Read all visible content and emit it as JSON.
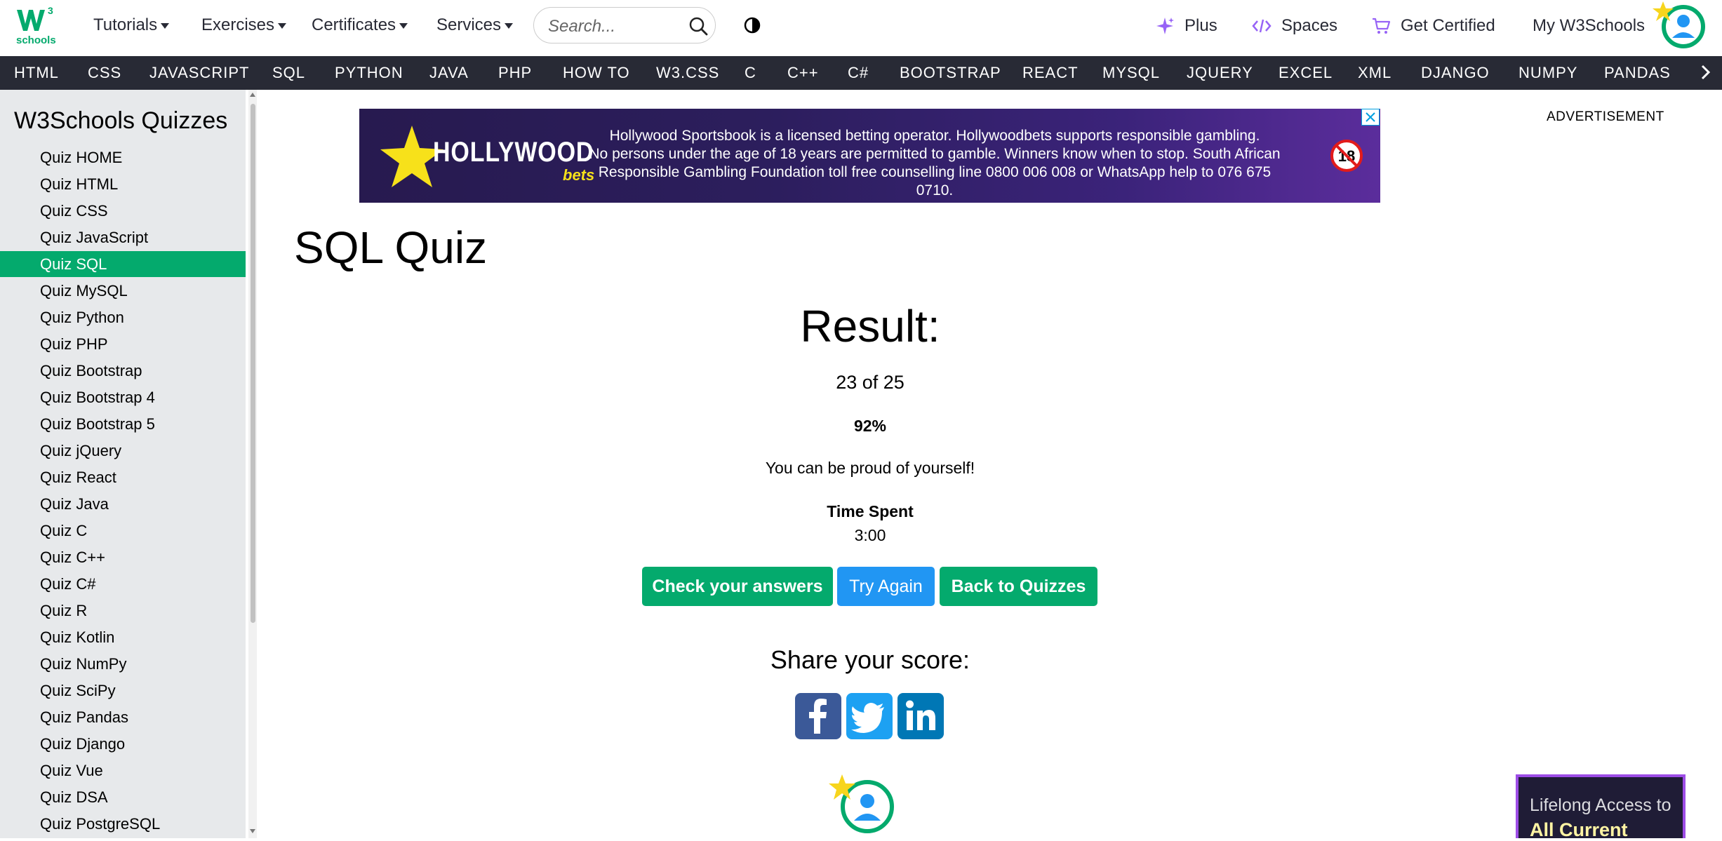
{
  "header": {
    "logo_text": "schools",
    "logo_sup": "3",
    "menus": [
      "Tutorials",
      "Exercises",
      "Certificates",
      "Services"
    ],
    "search_placeholder": "Search...",
    "right_links": {
      "plus": "Plus",
      "spaces": "Spaces",
      "certified": "Get Certified",
      "my": "My W3Schools"
    }
  },
  "subnav": [
    "HTML",
    "CSS",
    "JAVASCRIPT",
    "SQL",
    "PYTHON",
    "JAVA",
    "PHP",
    "HOW TO",
    "W3.CSS",
    "C",
    "C++",
    "C#",
    "BOOTSTRAP",
    "REACT",
    "MYSQL",
    "JQUERY",
    "EXCEL",
    "XML",
    "DJANGO",
    "NUMPY",
    "PANDAS"
  ],
  "sidebar": {
    "title": "W3Schools Quizzes",
    "active_index": 4,
    "items": [
      "Quiz HOME",
      "Quiz HTML",
      "Quiz CSS",
      "Quiz JavaScript",
      "Quiz SQL",
      "Quiz MySQL",
      "Quiz Python",
      "Quiz PHP",
      "Quiz Bootstrap",
      "Quiz Bootstrap 4",
      "Quiz Bootstrap 5",
      "Quiz jQuery",
      "Quiz React",
      "Quiz Java",
      "Quiz C",
      "Quiz C++",
      "Quiz C#",
      "Quiz R",
      "Quiz Kotlin",
      "Quiz NumPy",
      "Quiz SciPy",
      "Quiz Pandas",
      "Quiz Django",
      "Quiz Vue",
      "Quiz DSA",
      "Quiz PostgreSQL"
    ]
  },
  "ad": {
    "brand": "HOLLYWOOD",
    "brand_sub": "bets",
    "line1": "Hollywood Sportsbook is a licensed betting operator. Hollywoodbets supports responsible gambling.",
    "line2": "No persons under the age of 18 years are permitted to gamble. Winners know when to stop. South African",
    "line3": "Responsible Gambling Foundation toll free counselling line 0800 006 008 or WhatsApp help to 076 675 0710.",
    "age": "18",
    "label": "ADVERTISEMENT"
  },
  "main": {
    "title": "SQL Quiz",
    "result_heading": "Result:",
    "score": "23 of 25",
    "percent": "92%",
    "message": "You can be proud of yourself!",
    "time_label": "Time Spent",
    "time_value": "3:00",
    "buttons": {
      "check": "Check your answers",
      "retry": "Try Again",
      "back": "Back to Quizzes"
    },
    "share_label": "Share your score:"
  },
  "promo": {
    "line1": "Lifelong Access to",
    "line2": "All Current"
  },
  "colors": {
    "brand_green": "#04aa6d",
    "dark_nav": "#282a35",
    "blue": "#2196f3",
    "purple": "#9763f6"
  }
}
